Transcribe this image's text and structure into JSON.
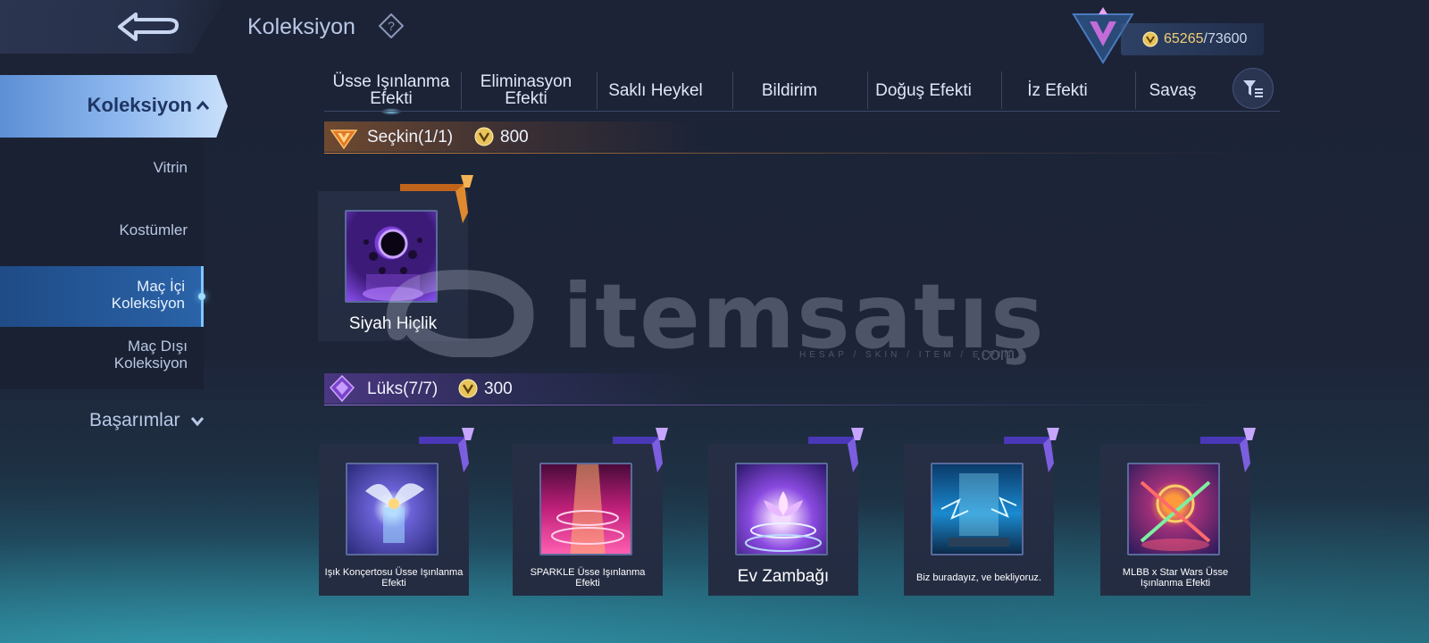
{
  "header": {
    "title": "Koleksiyon",
    "currency_current": "65265",
    "currency_separator": "/",
    "currency_max": "73600"
  },
  "sidebar": {
    "active_label": "Koleksiyon",
    "items": [
      {
        "label": "Vitrin"
      },
      {
        "label": "Kostümler"
      },
      {
        "label": "Maç İçi Koleksiyon"
      },
      {
        "label": "Maç Dışı Koleksiyon"
      }
    ],
    "active_item": "Maç İçi Koleksiyon",
    "achievements_label": "Başarımlar"
  },
  "tabs": [
    {
      "label": "Üsse Işınlanma Efekti",
      "active": true
    },
    {
      "label": "Eliminasyon Efekti",
      "active": false
    },
    {
      "label": "Saklı Heykel",
      "active": false
    },
    {
      "label": "Bildirim",
      "active": false
    },
    {
      "label": "Doğuş Efekti",
      "active": false
    },
    {
      "label": "İz Efekti",
      "active": false
    },
    {
      "label": "Savaş",
      "active": false
    }
  ],
  "sections": {
    "elite": {
      "title": "Seçkin(1/1)",
      "price": "800",
      "accent": "#d9883a"
    },
    "lux": {
      "title": "Lüks(7/7)",
      "price": "300",
      "accent": "#9a6ee0"
    }
  },
  "elite_items": [
    {
      "name": "Siyah Hiçlik",
      "icon": "black-void-icon"
    }
  ],
  "lux_items": [
    {
      "name": "Işık Konçertosu Üsse Işınlanma Efekti",
      "icon": "light-concerto-icon"
    },
    {
      "name": "SPARKLE Üsse Işınlanma Efekti",
      "icon": "sparkle-icon"
    },
    {
      "name": "Ev Zambağı",
      "icon": "lotus-icon"
    },
    {
      "name": "Biz buradayız, ve bekliyoruz.",
      "icon": "blue-portal-icon"
    },
    {
      "name": "MLBB x Star Wars Üsse Işınlanma Efekti",
      "icon": "star-wars-icon"
    }
  ],
  "watermark": {
    "text": "itemsatış",
    "sub": "HESAP / SKIN / ITEM / E-PIN",
    "suffix": ".com"
  }
}
